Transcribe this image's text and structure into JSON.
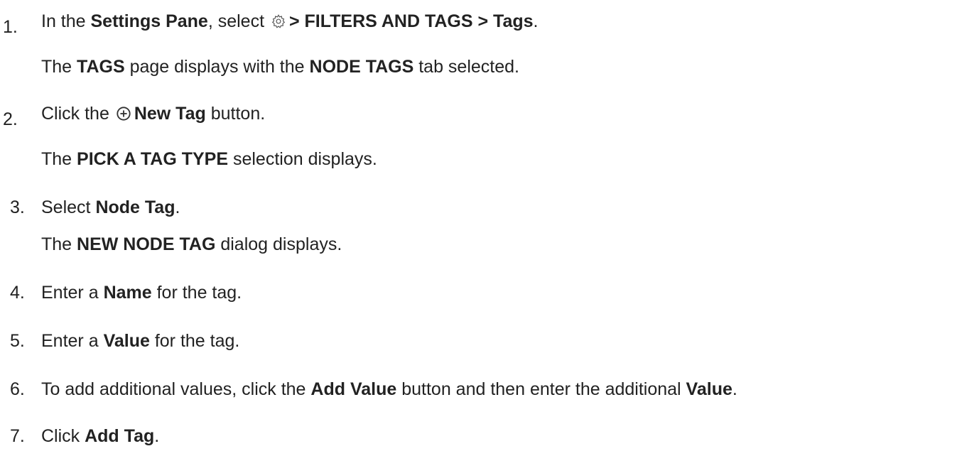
{
  "steps": [
    {
      "number": "1.",
      "text_parts": [
        "In the ",
        "Settings Pane",
        ", select ",
        "> FILTERS AND TAGS > Tags",
        "."
      ],
      "icon": "gear-icon",
      "result_parts": [
        "The ",
        "TAGS",
        " page displays with the ",
        "NODE TAGS",
        " tab selected."
      ]
    },
    {
      "number": "2.",
      "text_parts": [
        "Click the ",
        "New Tag",
        " button."
      ],
      "icon": "plus-circle-icon",
      "result_parts": [
        "The ",
        "PICK A TAG TYPE",
        " selection displays."
      ]
    },
    {
      "number": "3.",
      "text_parts": [
        "Select ",
        "Node Tag",
        "."
      ],
      "result_parts": [
        "The ",
        "NEW NODE TAG",
        " dialog displays."
      ]
    },
    {
      "number": "4.",
      "text_parts": [
        "Enter a ",
        "Name",
        " for the tag."
      ]
    },
    {
      "number": "5.",
      "text_parts": [
        "Enter a ",
        "Value",
        " for the tag."
      ]
    },
    {
      "number": "6.",
      "text_parts": [
        "To add additional values, click the ",
        "Add Value",
        " button and then enter the additional ",
        "Value",
        "."
      ]
    },
    {
      "number": "7.",
      "text_parts": [
        "Click ",
        "Add Tag",
        "."
      ]
    }
  ],
  "colors": {
    "text": "#222222",
    "icon_stroke": "#555555"
  }
}
